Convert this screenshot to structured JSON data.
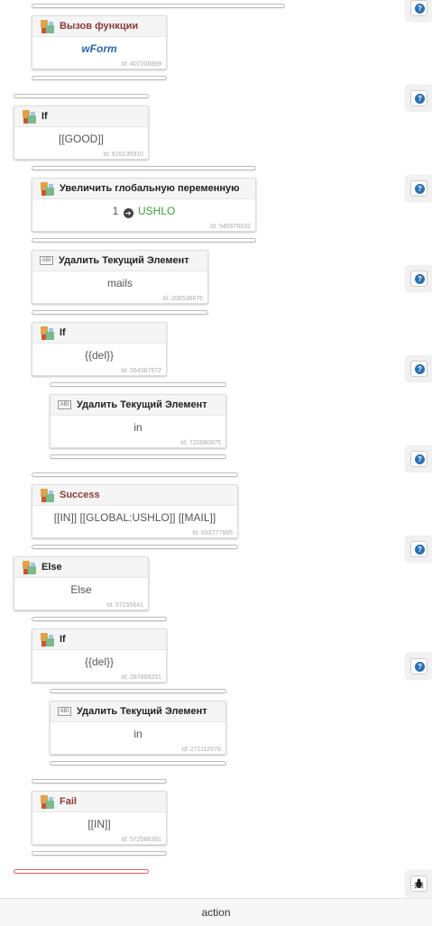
{
  "blocks": {
    "call_func": {
      "title": "Вызов функции",
      "value": "wForm",
      "id": "Id: 407208869"
    },
    "if_good": {
      "title": "If",
      "value": "[[GOOD]]",
      "id": "Id: 615135910"
    },
    "inc_global": {
      "title": "Увеличить глобальную переменную",
      "amount": "1",
      "variable": "USHLO",
      "id": "Id: 545976032"
    },
    "del_mails": {
      "title": "Удалить Текущий Элемент",
      "value": "mails",
      "id": "Id: 206536676"
    },
    "if_del_1": {
      "title": "If",
      "value": "{{del}}",
      "id": "Id: 564367972"
    },
    "del_in_1": {
      "title": "Удалить Текущий Элемент",
      "value": "in",
      "id": "Id: 720080875"
    },
    "success": {
      "title": "Success",
      "value": "[[IN]] [[GLOBAL:USHLO]] [[MAIL]]",
      "id": "Id: 693777895"
    },
    "else": {
      "title": "Else",
      "value": "Else",
      "id": "Id: 57155641"
    },
    "if_del_2": {
      "title": "If",
      "value": "{{del}}",
      "id": "Id: 287869251"
    },
    "del_in_2": {
      "title": "Удалить Текущий Элемент",
      "value": "in",
      "id": "Id: 271112076"
    },
    "fail": {
      "title": "Fail",
      "value": "[[IN]]",
      "id": "Id: 572588391"
    }
  },
  "icons": {
    "abl_label": "ABI",
    "help": "?",
    "bug": "bug-icon",
    "arrow": "➔"
  },
  "bottom_bar": {
    "label": "action"
  },
  "colors": {
    "func_value": "#2c67b2",
    "variable": "#3a9c3a",
    "title_red": "#8a3b3b",
    "help_icon": "#2a6fb2",
    "end_separator": "#e06666"
  }
}
